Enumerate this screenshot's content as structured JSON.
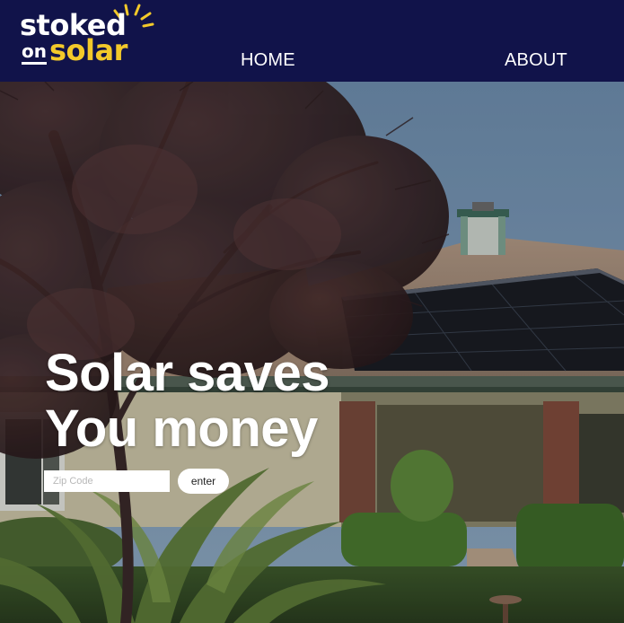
{
  "brand": {
    "line1": "stoked",
    "on": "on",
    "line2": "solar",
    "colors": {
      "navy": "#11134a",
      "yellow": "#f3c92a",
      "white": "#ffffff"
    }
  },
  "nav": {
    "items": [
      {
        "label": "HOME"
      },
      {
        "label": "ABOUT"
      }
    ]
  },
  "hero": {
    "headline_line1": "Solar saves",
    "headline_line2": "You money",
    "zip_placeholder": "Zip Code",
    "enter_label": "enter",
    "background_icon": "house-with-solar-panels-photo"
  }
}
